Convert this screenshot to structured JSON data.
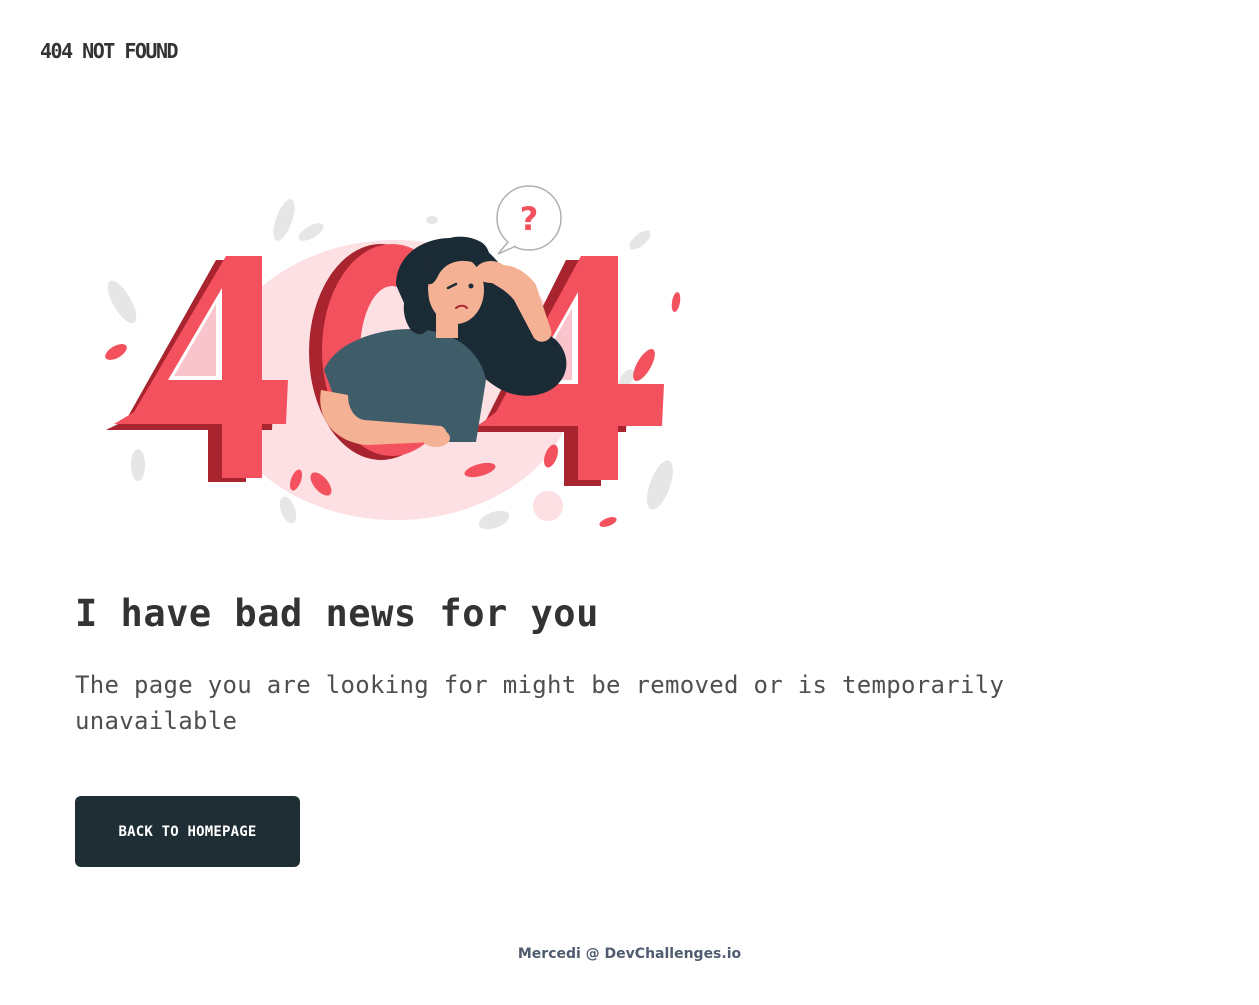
{
  "header": {
    "logo_text": "404 NOT FOUND"
  },
  "illustration": {
    "question_mark": "?",
    "colors": {
      "primary_red": "#F4515F",
      "dark_red": "#A8242F",
      "light_pink": "#FCE0E3",
      "hair": "#1B2B36",
      "shirt": "#3E5D68",
      "skin": "#F5B194",
      "leaf_gray": "#E9E9E9"
    }
  },
  "main": {
    "title": "I have bad news for you",
    "description": "The page you are looking for might be removed or is temporarily unavailable",
    "button_label": "BACK TO HOMEPAGE"
  },
  "footer": {
    "credit": "Mercedi @ DevChallenges.io"
  },
  "theme": {
    "button_bg": "#1F2E35",
    "text": "#333333"
  }
}
